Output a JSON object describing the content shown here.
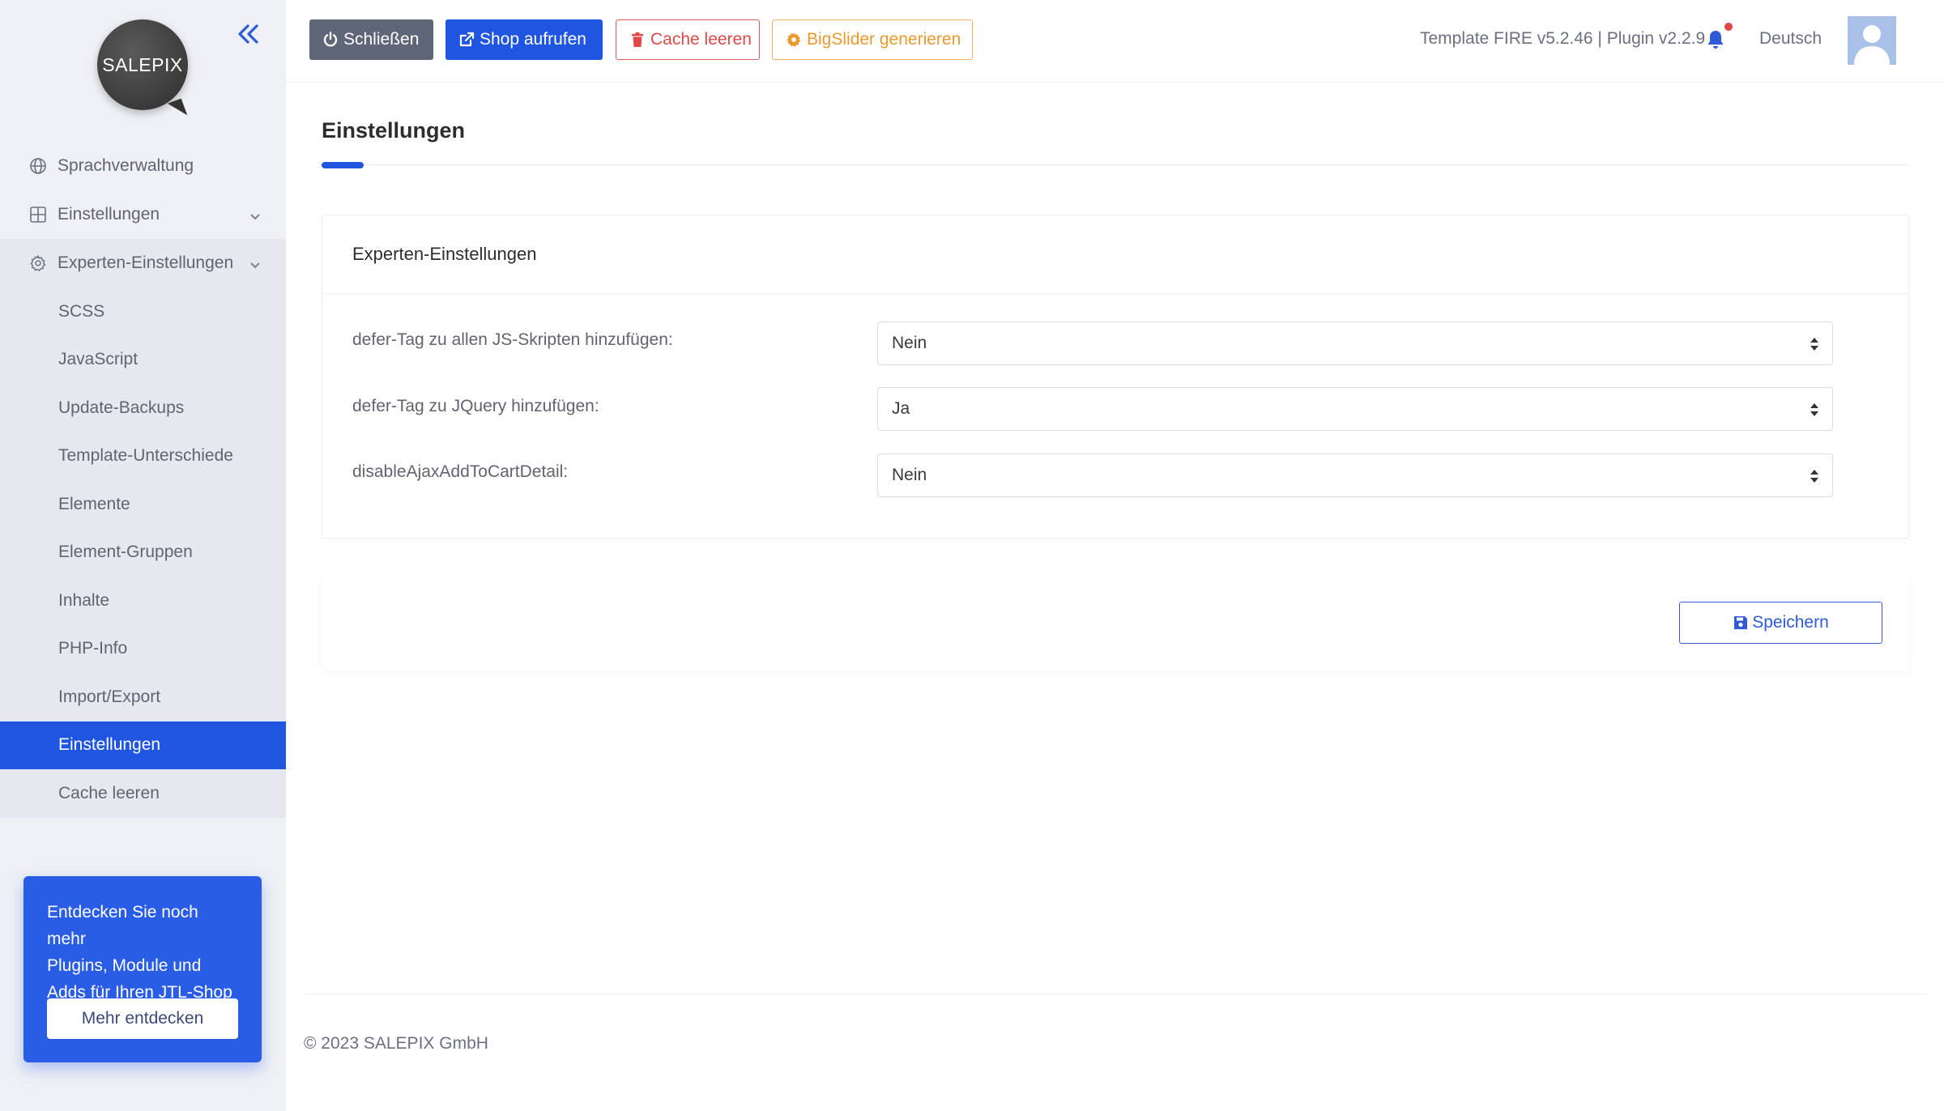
{
  "sidebar": {
    "logo_text": "SALEPIX",
    "items": [
      {
        "label": "Sprachverwaltung",
        "icon": "globe-icon"
      },
      {
        "label": "Einstellungen",
        "icon": "grid-icon"
      },
      {
        "label": "Experten-Einstellungen",
        "icon": "gear-icon"
      }
    ],
    "sub_items": [
      {
        "label": "SCSS"
      },
      {
        "label": "JavaScript"
      },
      {
        "label": "Update-Backups"
      },
      {
        "label": "Template-Unterschiede"
      },
      {
        "label": "Elemente"
      },
      {
        "label": "Element-Gruppen"
      },
      {
        "label": "Inhalte"
      },
      {
        "label": "PHP-Info"
      },
      {
        "label": "Import/Export"
      },
      {
        "label": "Einstellungen"
      },
      {
        "label": "Cache leeren"
      }
    ],
    "promo": {
      "line1": "Entdecken Sie noch mehr",
      "line2": "Plugins, Module und",
      "line3": "Adds für Ihren JTL-Shop",
      "button": "Mehr entdecken"
    }
  },
  "toolbar": {
    "close_label": "Schließen",
    "shop_label": "Shop aufrufen",
    "cache_label": "Cache leeren",
    "slider_label": "BigSlider generieren",
    "version": "Template FIRE v5.2.46 | Plugin v2.2.9",
    "language": "Deutsch"
  },
  "colors": {
    "accent": "#1f55e0",
    "danger": "#e04848",
    "warning": "#eb9a2e",
    "sidebar_bg": "#eef0f5"
  },
  "main": {
    "page_title": "Einstellungen",
    "card_title": "Experten-Einstellungen",
    "settings": [
      {
        "label": "defer-Tag zu allen JS-Skripten hinzufügen:",
        "value": "Nein"
      },
      {
        "label": "defer-Tag zu JQuery hinzufügen:",
        "value": "Ja"
      },
      {
        "label": "disableAjaxAddToCartDetail:",
        "value": "Nein"
      }
    ],
    "save_label": "Speichern"
  },
  "footer": {
    "copyright": "© 2023 SALEPIX GmbH"
  }
}
